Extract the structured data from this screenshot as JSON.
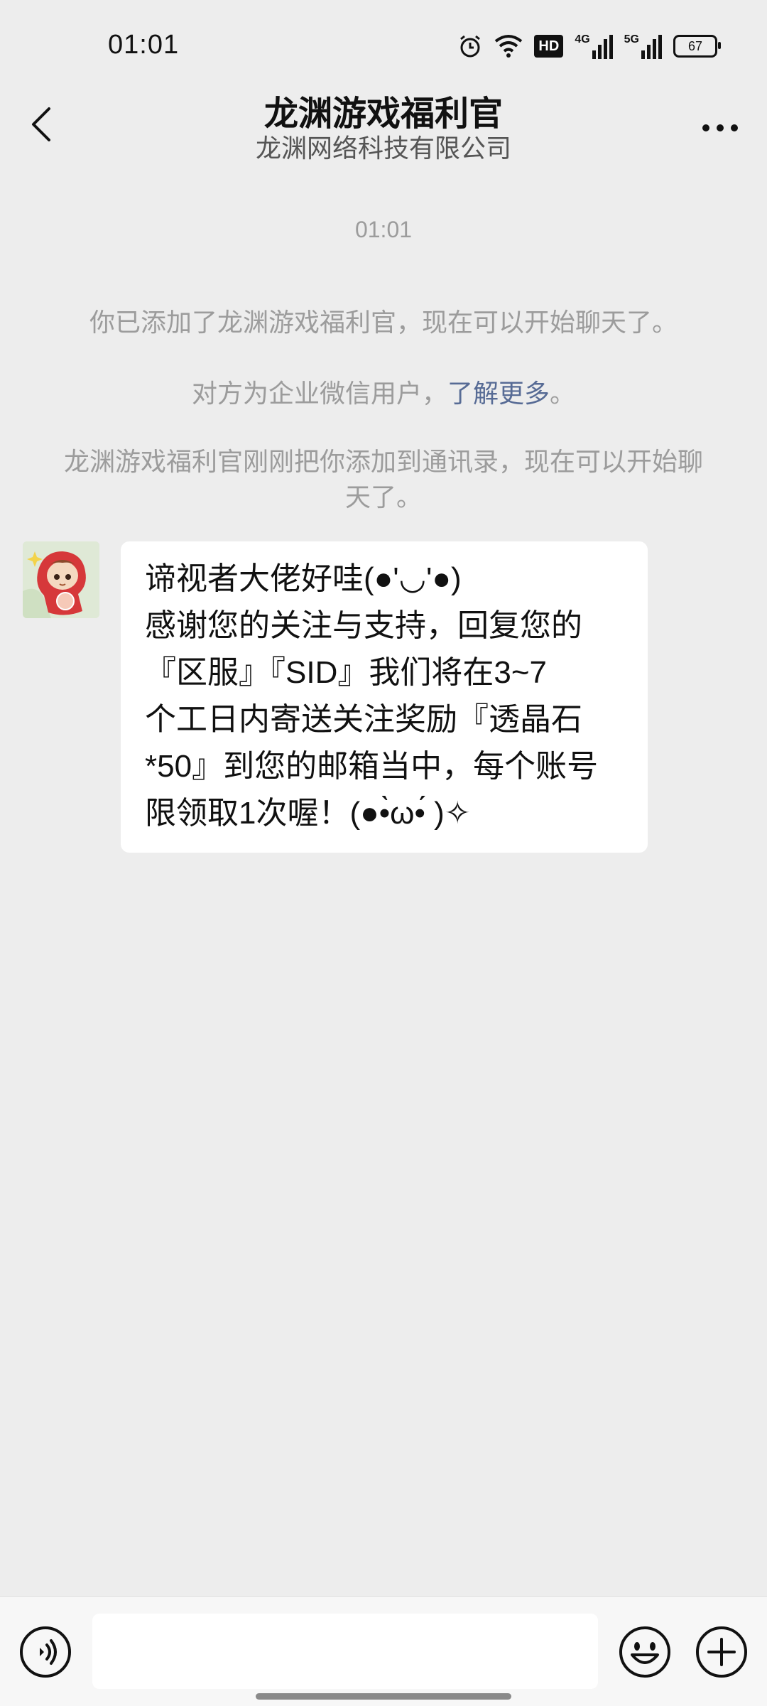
{
  "status_bar": {
    "time": "01:01",
    "battery": "67",
    "icons": [
      "alarm-icon",
      "wifi-icon",
      "hd-icon",
      "4g-signal-icon",
      "5g-signal-icon",
      "battery-icon"
    ],
    "hd_label": "HD",
    "net1_label": "4G",
    "net2_label": "5G"
  },
  "header": {
    "title": "龙渊游戏福利官",
    "subtitle": "龙渊网络科技有限公司",
    "back_icon": "chevron-left-icon",
    "more_icon": "more-dots-icon"
  },
  "chat": {
    "timestamp": "01:01",
    "system_messages": {
      "added": "你已添加了龙渊游戏福利官，现在可以开始聊天了。",
      "enterprise_prefix": "对方为企业微信用户，",
      "enterprise_link": "了解更多",
      "enterprise_suffix": "。",
      "contact_added": "龙渊游戏福利官刚刚把你添加到通讯录，现在可以开始聊天了。"
    },
    "messages": [
      {
        "sender": "龙渊游戏福利官",
        "lines": [
          "谛视者大佬好哇(●'◡'●)",
          "感谢您的关注与支持，回复您的",
          "『区服』『SID』我们将在3~7",
          "个工日内寄送关注奖励『透晶石",
          "*50』到您的邮箱当中，每个账号",
          "限领取1次喔！(●•̀ω•́ )✧"
        ]
      }
    ]
  },
  "input_bar": {
    "voice_icon": "voice-icon",
    "input_value": "",
    "emoji_icon": "emoji-icon",
    "plus_icon": "plus-icon"
  },
  "colors": {
    "background": "#ededed",
    "bubble": "#ffffff",
    "link": "#576b95",
    "system_text": "#9c9c9c"
  }
}
